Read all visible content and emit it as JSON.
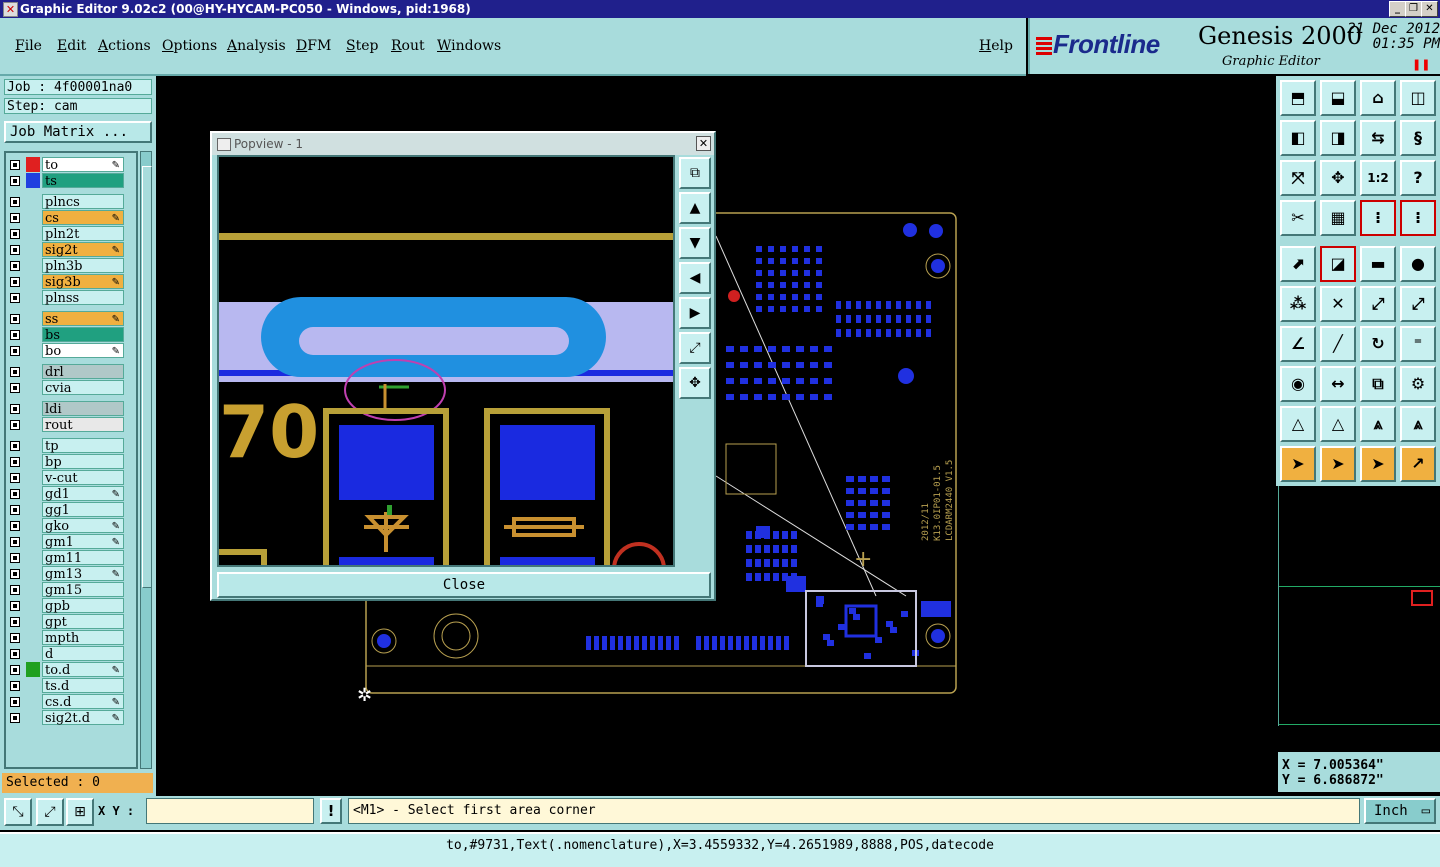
{
  "window": {
    "title": "Graphic Editor 9.02c2 (00@HY-HYCAM-PC050 - Windows, pid:1968)"
  },
  "menubar": {
    "items": [
      "File",
      "Edit",
      "Actions",
      "Options",
      "Analysis",
      "DFM",
      "Step",
      "Rout",
      "Windows"
    ],
    "help": "Help"
  },
  "brand": {
    "logo": "Frontline",
    "product": "Genesis 2000",
    "subtitle": "Graphic Editor",
    "date": "21 Dec 2012",
    "time": "01:35 PM"
  },
  "leftpanel": {
    "job": "Job : 4f00001na0",
    "step": "Step: cam",
    "job_matrix": "Job Matrix ...",
    "selected": "Selected : 0"
  },
  "layers": [
    {
      "name": "to",
      "color": "#e02020",
      "bg": "#ffffff",
      "edit": true,
      "hl": true
    },
    {
      "name": "ts",
      "color": "#2040e0",
      "bg": "#20a080",
      "edit": false
    },
    {
      "name": "plncs",
      "bg": "#c8f0f0"
    },
    {
      "name": "cs",
      "bg": "#f0b040",
      "edit": true
    },
    {
      "name": "pln2t",
      "bg": "#c8f0f0"
    },
    {
      "name": "sig2t",
      "bg": "#f0b040",
      "edit": true
    },
    {
      "name": "pln3b",
      "bg": "#c8f0f0"
    },
    {
      "name": "sig3b",
      "bg": "#f0b040",
      "edit": true
    },
    {
      "name": "plnss",
      "bg": "#c8f0f0"
    },
    {
      "name": "ss",
      "bg": "#f0b040",
      "edit": true
    },
    {
      "name": "bs",
      "bg": "#20a080"
    },
    {
      "name": "bo",
      "bg": "#ffffff",
      "edit": true
    },
    {
      "name": "drl",
      "bg": "#b0c8c8"
    },
    {
      "name": "cvia",
      "bg": "#c8f0f0"
    },
    {
      "name": "ldi",
      "bg": "#b0c8c8"
    },
    {
      "name": "rout",
      "bg": "#e8e8e8"
    },
    {
      "name": "tp",
      "bg": "#c8f0f0"
    },
    {
      "name": "bp",
      "bg": "#c8f0f0"
    },
    {
      "name": "v-cut",
      "bg": "#c8f0f0"
    },
    {
      "name": "gd1",
      "bg": "#c8f0f0",
      "edit": true
    },
    {
      "name": "gg1",
      "bg": "#c8f0f0"
    },
    {
      "name": "gko",
      "bg": "#c8f0f0",
      "edit": true
    },
    {
      "name": "gm1",
      "bg": "#c8f0f0",
      "edit": true
    },
    {
      "name": "gm11",
      "bg": "#c8f0f0"
    },
    {
      "name": "gm13",
      "bg": "#c8f0f0",
      "edit": true
    },
    {
      "name": "gm15",
      "bg": "#c8f0f0"
    },
    {
      "name": "gpb",
      "bg": "#c8f0f0"
    },
    {
      "name": "gpt",
      "bg": "#c8f0f0"
    },
    {
      "name": "mpth",
      "bg": "#c8f0f0"
    },
    {
      "name": "d",
      "bg": "#c8f0f0"
    },
    {
      "name": "to.d",
      "color": "#20a020",
      "bg": "#c8f0f0",
      "edit": true
    },
    {
      "name": "ts.d",
      "bg": "#c8f0f0"
    },
    {
      "name": "cs.d",
      "bg": "#c8f0f0",
      "edit": true
    },
    {
      "name": "sig2t.d",
      "bg": "#c8f0f0",
      "edit": true
    }
  ],
  "popview": {
    "title": "Popview - 1",
    "close_label": "Close",
    "label_text": "70"
  },
  "coords": {
    "x": "X = 7.005364\"",
    "y": "Y = 6.686872\""
  },
  "bottombar": {
    "xy_label": "X Y :",
    "xy_value": "",
    "warn": "!",
    "prompt": "<M1> - Select first area corner",
    "unit": "Inch"
  },
  "status": {
    "text": "to,#9731,Text(.nomenclature),X=3.4559332,Y=4.2651989,8888,POS,datecode"
  },
  "pcb_labels": [
    "2012/11",
    "K13.0IP01-01.5",
    "LCDARM2440 V1.5"
  ]
}
